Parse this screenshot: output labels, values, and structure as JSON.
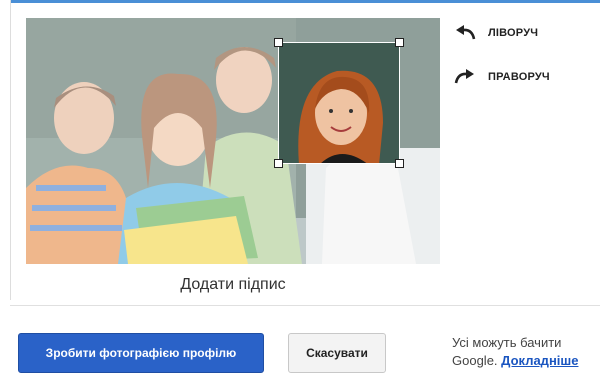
{
  "rotate": {
    "left_label": "ЛІВОРУЧ",
    "right_label": "ПРАВОРУЧ",
    "left_icon": "rotate-left-icon",
    "right_icon": "rotate-right-icon"
  },
  "caption": "Додати підпис",
  "buttons": {
    "primary_label": "Зробити фотографією профілю",
    "cancel_label": "Скасувати"
  },
  "notice": {
    "line1": "Усі можуть бачити",
    "line2_prefix": "Google.",
    "link_label": "Докладніше"
  },
  "colors": {
    "accent": "#2a62c8",
    "link": "#1a55c0"
  }
}
